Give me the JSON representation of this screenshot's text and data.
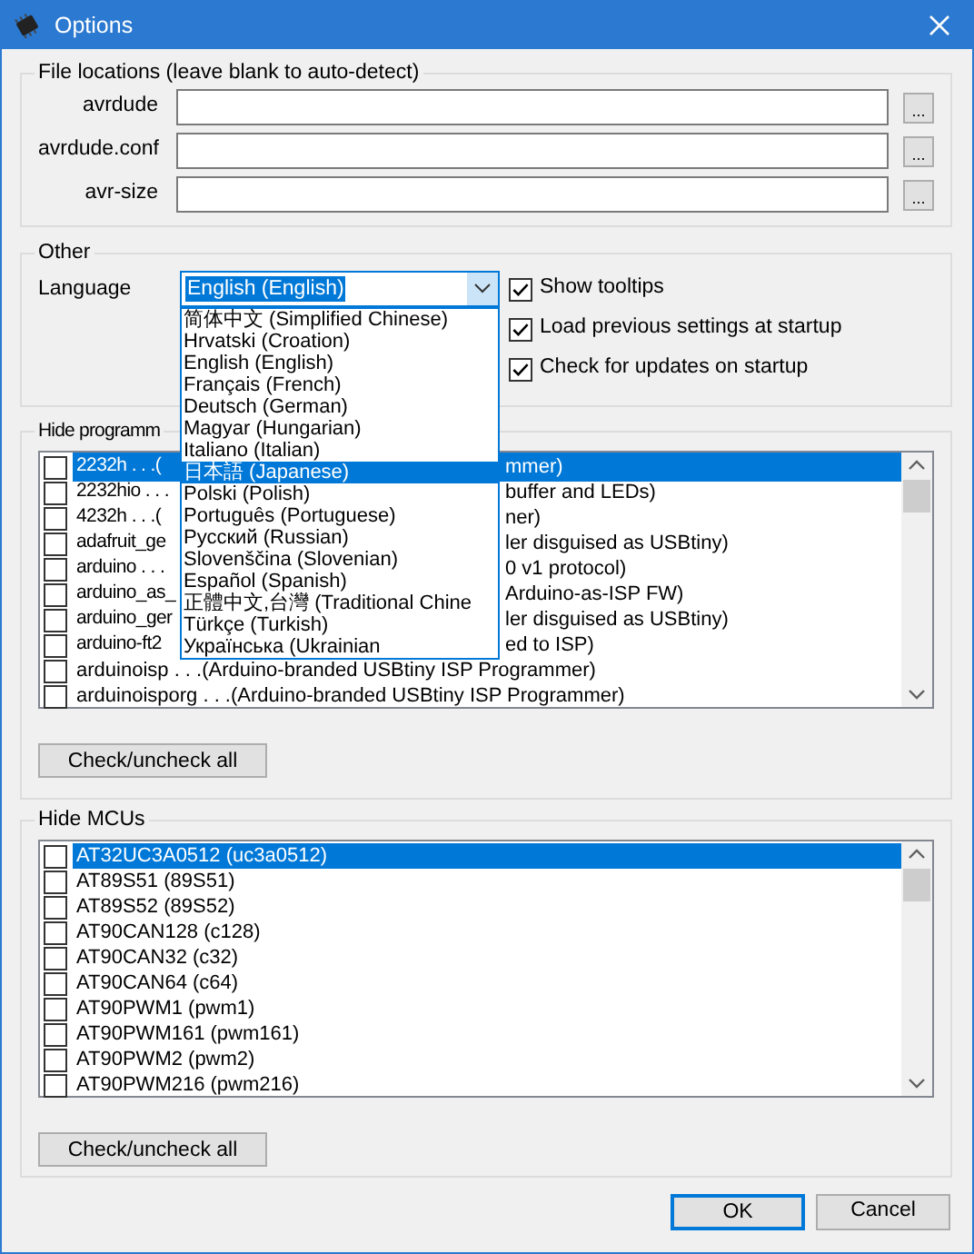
{
  "window": {
    "title": "Options"
  },
  "file_locations": {
    "title": "File locations (leave blank to auto-detect)",
    "fields": [
      {
        "label": "avrdude",
        "button": "..."
      },
      {
        "label": "avrdude.conf",
        "button": "..."
      },
      {
        "label": "avr-size",
        "button": "..."
      }
    ]
  },
  "other": {
    "title": "Other",
    "language": {
      "label": "Language",
      "value": "English (English)",
      "expanded": true,
      "options": [
        {
          "label": "简体中文 (Simplified Chinese)",
          "highlighted": false
        },
        {
          "label": "Hrvatski (Croation)",
          "highlighted": false
        },
        {
          "label": "English (English)",
          "highlighted": false
        },
        {
          "label": "Français (French)",
          "highlighted": false
        },
        {
          "label": "Deutsch (German)",
          "highlighted": false
        },
        {
          "label": "Magyar (Hungarian)",
          "highlighted": false
        },
        {
          "label": "Italiano (Italian)",
          "highlighted": false
        },
        {
          "label": "日本語 (Japanese)",
          "highlighted": true
        },
        {
          "label": "Polski (Polish)",
          "highlighted": false
        },
        {
          "label": "Português (Portuguese)",
          "highlighted": false
        },
        {
          "label": "Русский (Russian)",
          "highlighted": false
        },
        {
          "label": "Slovenščina (Slovenian)",
          "highlighted": false
        },
        {
          "label": "Español (Spanish)",
          "highlighted": false
        },
        {
          "label": "正體中文,台灣 (Traditional Chine",
          "highlighted": false
        },
        {
          "label": "Türkçe (Turkish)",
          "highlighted": false
        },
        {
          "label": "Українська (Ukrainian",
          "highlighted": false
        }
      ]
    },
    "checkboxes": [
      {
        "label": "Show tooltips",
        "checked": true
      },
      {
        "label": "Load previous settings at startup",
        "checked": true
      },
      {
        "label": "Check for updates on startup",
        "checked": true
      }
    ]
  },
  "hide_programmers": {
    "title": "Hide programm",
    "rows": [
      {
        "left": "2232h . . .(",
        "right": "mmer)",
        "checked": false,
        "selected": true
      },
      {
        "left": "2232hio . . .",
        "right": "buffer and LEDs)",
        "checked": false,
        "selected": false
      },
      {
        "left": "4232h . . .(",
        "right": "ner)",
        "checked": false,
        "selected": false
      },
      {
        "left": "adafruit_ge",
        "right": "ler disguised as USBtiny)",
        "checked": false,
        "selected": false
      },
      {
        "left": "arduino . . .",
        "right": "0 v1 protocol)",
        "checked": false,
        "selected": false
      },
      {
        "left": "arduino_as_",
        "right": "Arduino-as-ISP FW)",
        "checked": false,
        "selected": false
      },
      {
        "left": "arduino_ger",
        "right": "ler disguised as USBtiny)",
        "checked": false,
        "selected": false
      },
      {
        "left": "arduino-ft2",
        "right": "ed to ISP)",
        "checked": false,
        "selected": false
      },
      {
        "text": "arduinoisp . . .(Arduino-branded USBtiny ISP Programmer)",
        "checked": false,
        "selected": false
      },
      {
        "text": "arduinoisporg . . .(Arduino-branded USBtiny ISP Programmer)",
        "checked": false,
        "selected": false
      }
    ],
    "button": "Check/uncheck all"
  },
  "hide_mcus": {
    "title": "Hide MCUs",
    "rows": [
      {
        "text": "AT32UC3A0512 (uc3a0512)",
        "checked": false,
        "selected": true
      },
      {
        "text": "AT89S51 (89S51)",
        "checked": false,
        "selected": false
      },
      {
        "text": "AT89S52 (89S52)",
        "checked": false,
        "selected": false
      },
      {
        "text": "AT90CAN128 (c128)",
        "checked": false,
        "selected": false
      },
      {
        "text": "AT90CAN32 (c32)",
        "checked": false,
        "selected": false
      },
      {
        "text": "AT90CAN64 (c64)",
        "checked": false,
        "selected": false
      },
      {
        "text": "AT90PWM1 (pwm1)",
        "checked": false,
        "selected": false
      },
      {
        "text": "AT90PWM161 (pwm161)",
        "checked": false,
        "selected": false
      },
      {
        "text": "AT90PWM2 (pwm2)",
        "checked": false,
        "selected": false
      },
      {
        "text": "AT90PWM216 (pwm216)",
        "checked": false,
        "selected": false
      }
    ],
    "button": "Check/uncheck all"
  },
  "buttons": [
    {
      "label": "OK",
      "default": true
    },
    {
      "label": "Cancel",
      "default": false
    }
  ]
}
